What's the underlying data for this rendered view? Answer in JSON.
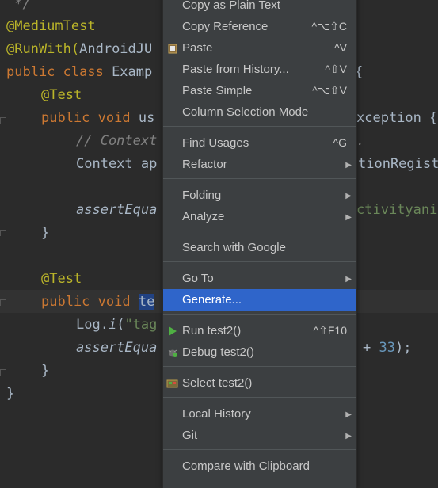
{
  "code": {
    "l0": " */",
    "l1": "@MediumTest",
    "l2a": "@RunWith(",
    "l2b": "AndroidJU",
    "l3a": "public class ",
    "l3b": "Examp",
    "l3c": "{",
    "l4": "@Test",
    "l5a": "public void ",
    "l5b": "us",
    "l5c": "xception {",
    "l6a": "// Context",
    "l6b": ".",
    "l7a": "Context ap",
    "l7b": "tionRegist",
    "l8a": "assertEqua",
    "l8b": "ctivityani",
    "l9": "}",
    "l10": "@Test",
    "l11a": "public void ",
    "l11b": "te",
    "l12a": "Log.",
    "l12b": "i",
    "l12c": "(",
    "l12d": "\"tag",
    "l13a": "assertEqua",
    "l13b": "+ ",
    "l13c": "33",
    "l13d": ");",
    "l14": "}",
    "l15": "}"
  },
  "menu": {
    "items": [
      {
        "label": "Copy as Plain Text",
        "shortcut": ""
      },
      {
        "label": "Copy Reference",
        "shortcut": "^⌥⇧C"
      },
      {
        "label": "Paste",
        "shortcut": "^V"
      },
      {
        "label": "Paste from History...",
        "shortcut": "^⇧V"
      },
      {
        "label": "Paste Simple",
        "shortcut": "^⌥⇧V"
      },
      {
        "label": "Column Selection Mode",
        "shortcut": ""
      },
      {
        "label": "Find Usages",
        "shortcut": "^G"
      },
      {
        "label": "Refactor",
        "shortcut": ""
      },
      {
        "label": "Folding",
        "shortcut": ""
      },
      {
        "label": "Analyze",
        "shortcut": ""
      },
      {
        "label": "Search with Google",
        "shortcut": ""
      },
      {
        "label": "Go To",
        "shortcut": ""
      },
      {
        "label": "Generate...",
        "shortcut": ""
      },
      {
        "label": "Run test2()",
        "shortcut": "^⇧F10"
      },
      {
        "label": "Debug test2()",
        "shortcut": ""
      },
      {
        "label": "Select test2()",
        "shortcut": ""
      },
      {
        "label": "Local History",
        "shortcut": ""
      },
      {
        "label": "Git",
        "shortcut": ""
      },
      {
        "label": "Compare with Clipboard",
        "shortcut": ""
      }
    ],
    "submenu_arrow": "▶"
  }
}
